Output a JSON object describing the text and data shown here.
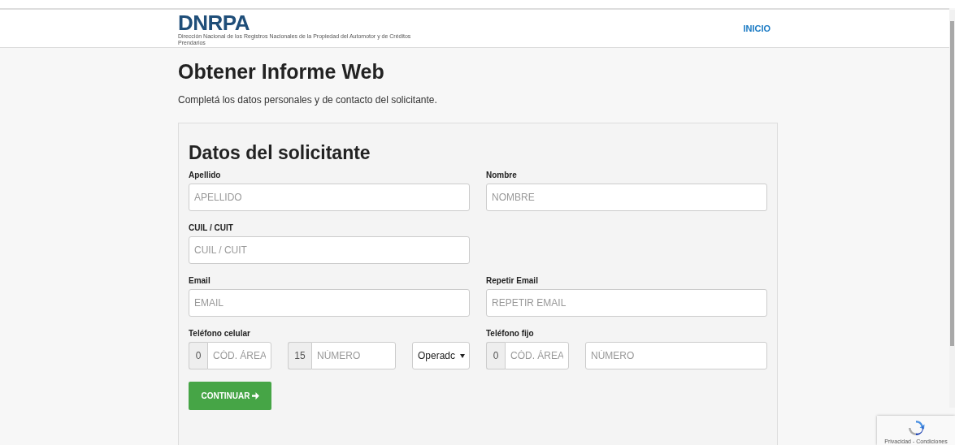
{
  "header": {
    "logo": {
      "title": "DNRPA",
      "subtitle": "Dirección Nacional de los Registros Nacionales de la Propiedad del Automotor y de Créditos Prendarios"
    },
    "nav": [
      {
        "label": "INICIO"
      }
    ]
  },
  "page": {
    "title": "Obtener Informe Web",
    "intro": "Completá los datos personales y de contacto del solicitante."
  },
  "form": {
    "title": "Datos del solicitante",
    "rows": [
      [
        {
          "kind": "text",
          "label": "Apellido",
          "placeholder": "APELLIDO"
        },
        {
          "kind": "text",
          "label": "Nombre",
          "placeholder": "NOMBRE"
        }
      ],
      [
        {
          "kind": "text",
          "label": "CUIL / CUIT",
          "placeholder": "CUIL / CUIT"
        }
      ],
      [
        {
          "kind": "text",
          "label": "Email",
          "placeholder": "EMAIL"
        },
        {
          "kind": "text",
          "label": "Repetir Email",
          "placeholder": "REPETIR EMAIL"
        }
      ],
      [
        {
          "kind": "phone",
          "label": "Teléfono celular",
          "parts": [
            {
              "kind": "prefixed",
              "prefix": "0",
              "placeholder": "CÓD. ÁREA"
            },
            {
              "kind": "prefixed",
              "prefix": "15",
              "placeholder": "NÚMERO"
            },
            {
              "kind": "select",
              "value": "Operadc"
            }
          ]
        },
        {
          "kind": "phone",
          "label": "Teléfono fijo",
          "parts": [
            {
              "kind": "prefixed",
              "prefix": "0",
              "placeholder": "CÓD. ÁREA"
            },
            {
              "kind": "plain",
              "placeholder": "NÚMERO"
            }
          ]
        }
      ]
    ],
    "submit": {
      "label": "CONTINUAR"
    }
  },
  "recaptcha": {
    "footer": "Privacidad - Condiciones"
  }
}
